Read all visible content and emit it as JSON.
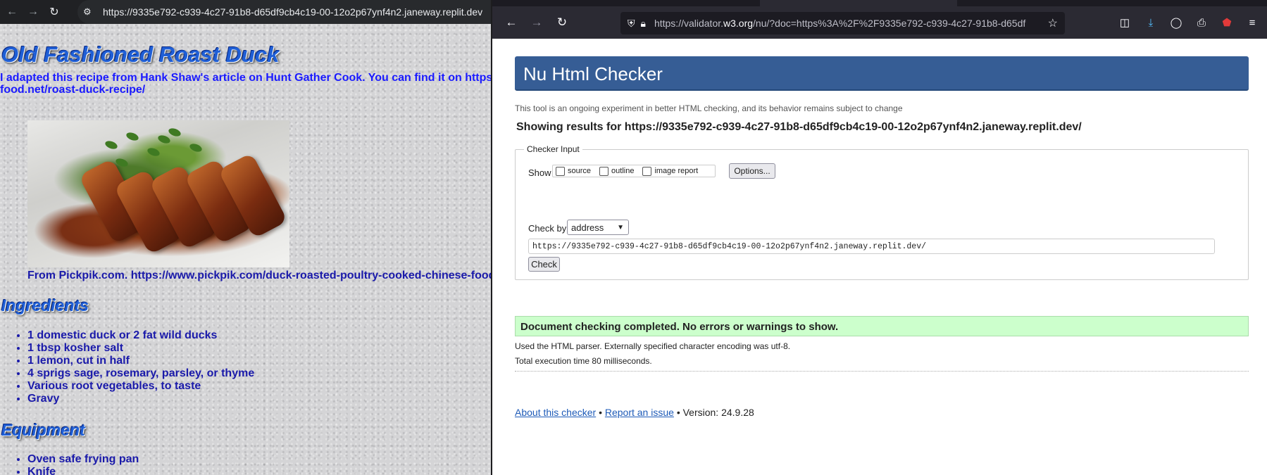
{
  "left_browser": {
    "url": "https://9335e792-c939-4c27-91b8-d65df9cb4c19-00-12o2p67ynf4n2.janeway.replit.dev",
    "back_icon": "arrow-left-icon",
    "forward_icon": "arrow-right-icon",
    "reload_icon": "reload-icon",
    "site_info_icon": "tune-icon"
  },
  "recipe": {
    "title": "Old Fashioned Roast Duck",
    "intro": "I adapted this recipe from Hank Shaw's article on Hunt Gather Cook. You can find it on https://honest-food.net/roast-duck-recipe/",
    "intro_line1": "I adapted this recipe from Hank Shaw's article on Hunt Gather Cook. You can find it on https",
    "intro_line2": "food.net/roast-duck-recipe/",
    "photo_credit": "From Pickpik.com. https://www.pickpik.com/duck-roasted-poultry-cooked-chinese-food",
    "ingredients_heading": "Ingredients",
    "ingredients": [
      "1 domestic duck or 2 fat wild ducks",
      "1 tbsp kosher salt",
      "1 lemon, cut in half",
      "4 sprigs sage, rosemary, parsley, or thyme",
      "Various root vegetables, to taste",
      "Gravy"
    ],
    "equipment_heading": "Equipment",
    "equipment": [
      "Oven safe frying pan",
      "Knife"
    ]
  },
  "right_browser": {
    "url_prefix": "https://validator.",
    "url_host": "w3.org",
    "url_suffix": "/nu/?doc=https%3A%2F%2F9335e792-c939-4c27-91b8-d65df",
    "icons": [
      "pocket-icon",
      "download-icon",
      "account-icon",
      "extensions-icon",
      "ublock-icon",
      "menu-icon"
    ]
  },
  "validator": {
    "banner": "Nu Html Checker",
    "tagline": "This tool is an ongoing experiment in better HTML checking, and its behavior remains subject to change",
    "results_for": "Showing results for https://9335e792-c939-4c27-91b8-d65df9cb4c19-00-12o2p67ynf4n2.janeway.replit.dev/",
    "legend": "Checker Input",
    "show_label": "Show",
    "show_options": [
      "source",
      "outline",
      "image report"
    ],
    "options_button": "Options...",
    "check_by_label": "Check by",
    "check_by_value": "address",
    "address_value": "https://9335e792-c939-4c27-91b8-d65df9cb4c19-00-12o2p67ynf4n2.janeway.replit.dev/",
    "check_button": "Check",
    "success": "Document checking completed. No errors or warnings to show.",
    "parser_info": "Used the HTML parser. Externally specified character encoding was utf-8.",
    "exec_time": "Total execution time 80 milliseconds.",
    "footer_about": "About this checker",
    "footer_sep": "•",
    "footer_report": "Report an issue",
    "footer_version": "• Version: 24.9.28"
  }
}
